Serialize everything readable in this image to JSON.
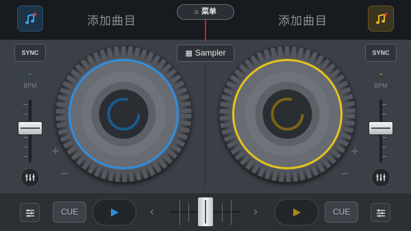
{
  "top": {
    "left_track_label": "添加曲目",
    "right_track_label": "添加曲目",
    "menu_label": "菜单"
  },
  "sampler_label": "Sampler",
  "deck_left": {
    "sync_label": "SYNC",
    "bpm_value": "-",
    "bpm_label": "BPM",
    "cue_label": "CUE",
    "accent": "#2f8fe0"
  },
  "deck_right": {
    "sync_label": "SYNC",
    "bpm_value": "-",
    "bpm_label": "BPM",
    "cue_label": "CUE",
    "accent": "#e8c21c"
  },
  "pitch_plus": "+",
  "pitch_minus": "−",
  "crossfader_left_arrow": "‹",
  "crossfader_right_arrow": "›",
  "icons": {
    "add_track": "music-note-plus-icon",
    "menu": "home-icon",
    "sampler": "grid-icon",
    "eq": "equalizer-icon",
    "mixer": "sliders-icon",
    "play": "play-icon"
  }
}
